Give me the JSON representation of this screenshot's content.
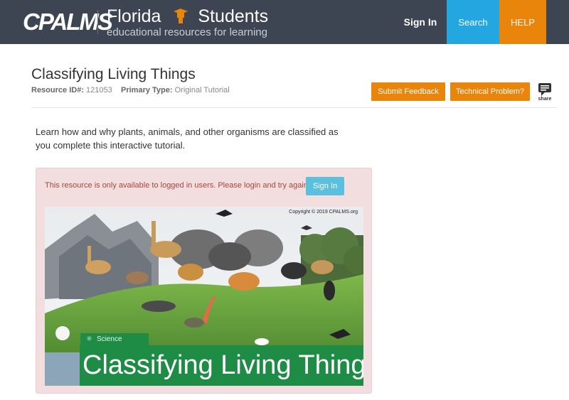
{
  "header": {
    "logo_text": "CPALMS",
    "brand_title_left": "Florida",
    "brand_title_right": "Students",
    "brand_subtitle": "educational resources for learning",
    "nav": {
      "sign_in": "Sign In",
      "search": "Search",
      "help": "HELP"
    },
    "colors": {
      "bar": "#3d4552",
      "search": "#24a6e0",
      "help": "#e8850a"
    }
  },
  "resource": {
    "title": "Classifying Living Things",
    "id_label": "Resource ID#:",
    "id_value": "121053",
    "type_label": "Primary Type:",
    "type_value": "Original Tutorial",
    "submit_feedback": "Submit Feedback",
    "technical_problem": "Technical Problem?",
    "share_label": "share",
    "description": "Learn how and why plants, animals, and other organisms are classified as you complete this interactive tutorial."
  },
  "login_panel": {
    "message": "This resource is only available to logged in users. Please login and try again.",
    "sign_in": "Sign In"
  },
  "hero": {
    "copyright": "Copyright © 2019 CPALMS.org",
    "subject": "Science",
    "title": "Classifying Living Things"
  }
}
